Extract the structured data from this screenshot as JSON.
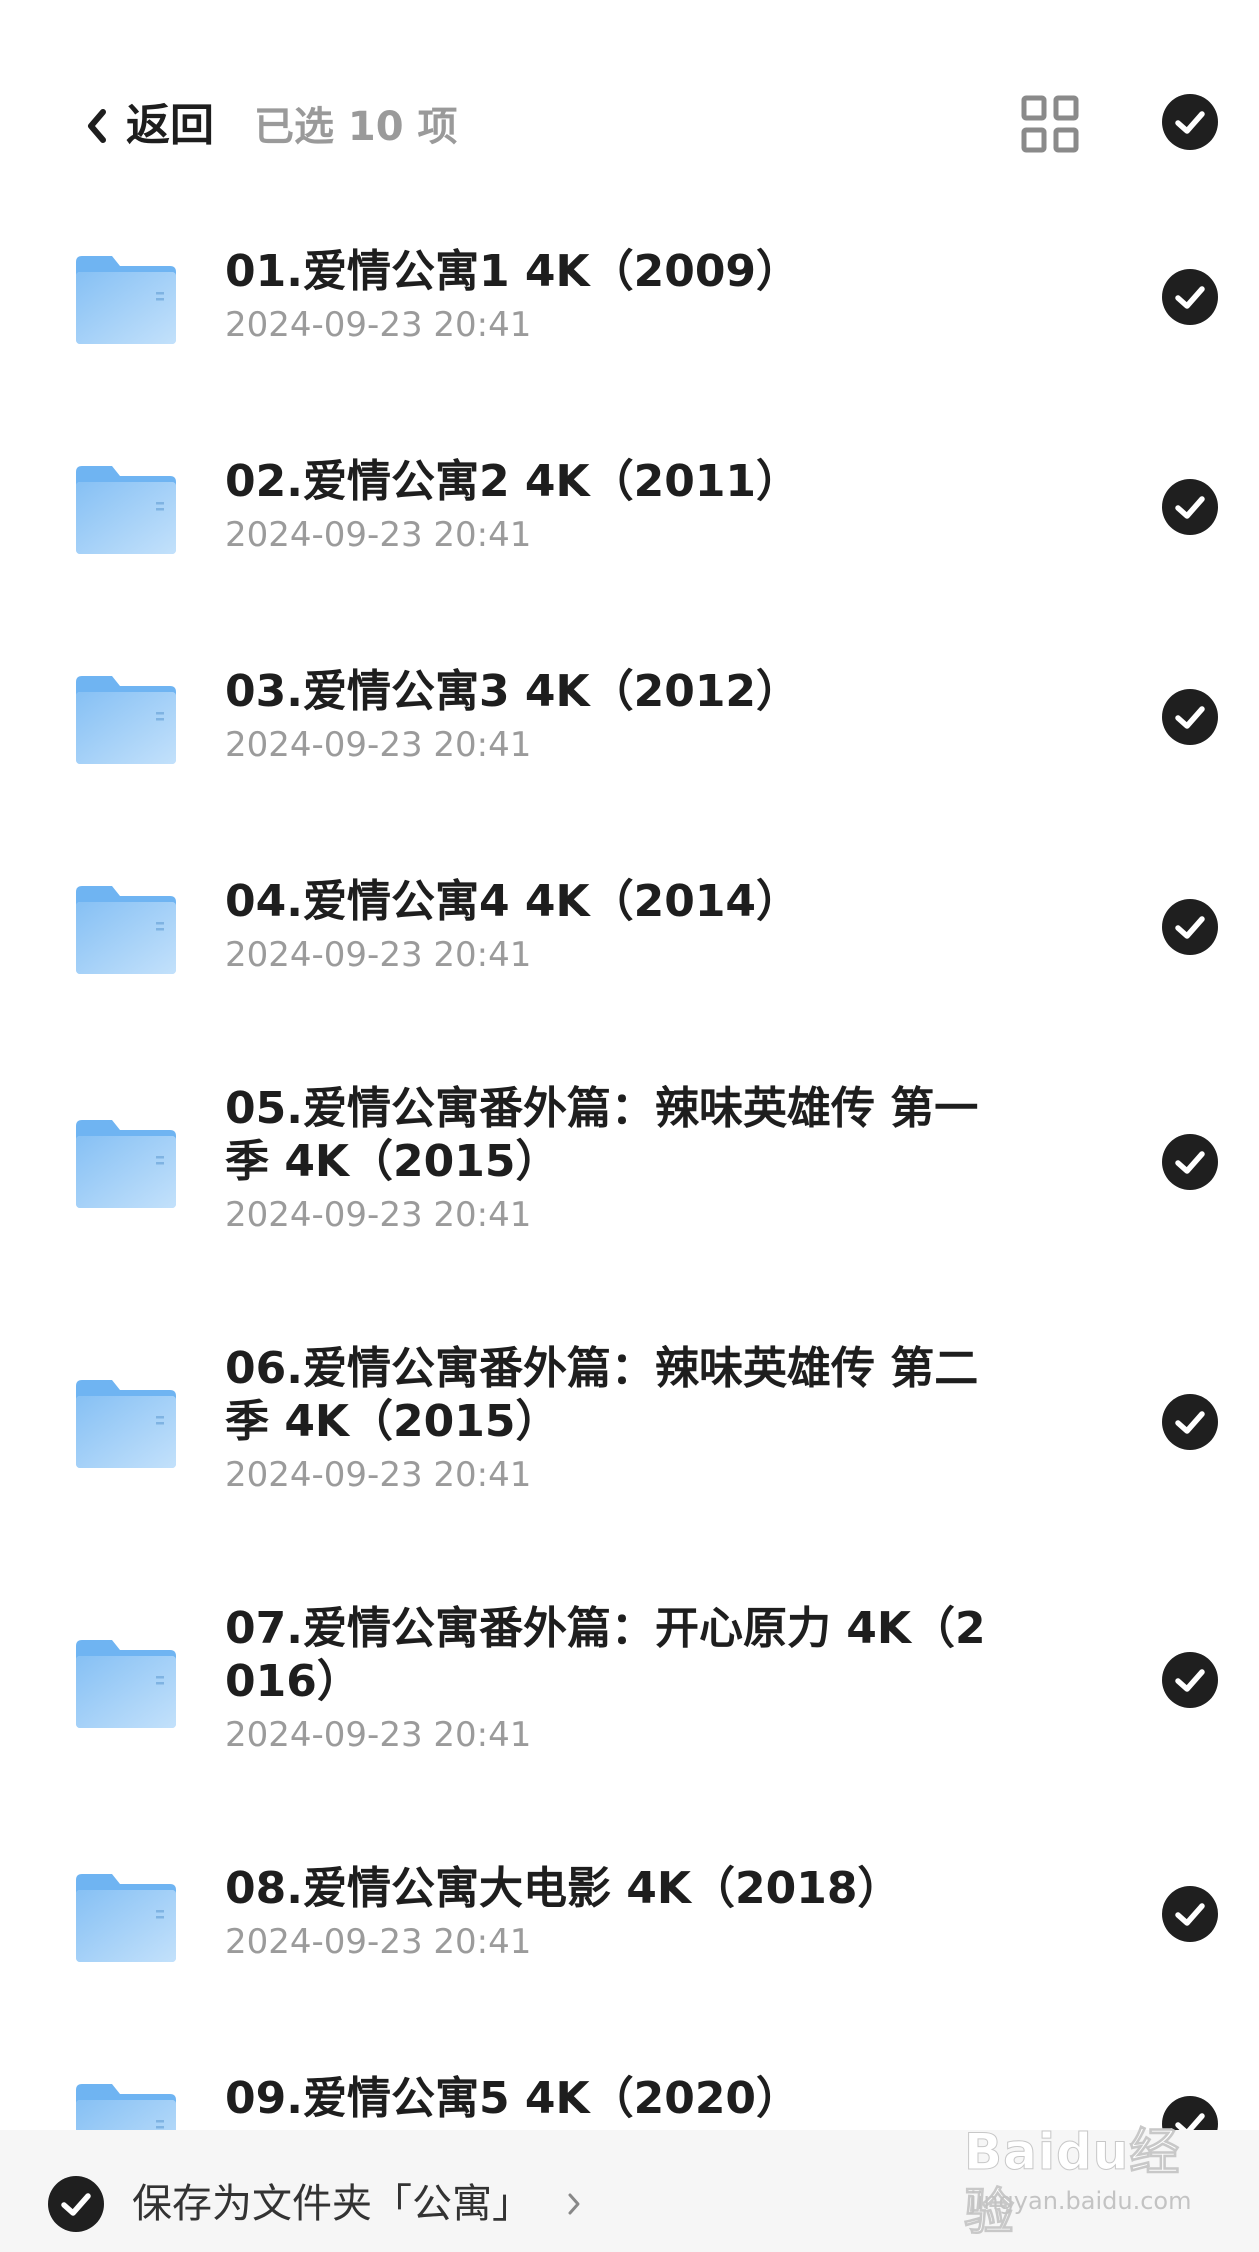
{
  "header": {
    "back_label": "返回",
    "selection_count": "已选 10 项"
  },
  "colors": {
    "accent_check": "#1f1f1f",
    "folder_blue": "#6fb4f2",
    "text_primary": "#1e1e1e",
    "text_secondary": "#9b9b9b"
  },
  "files": [
    {
      "name": "01.爱情公寓1 4K（2009）",
      "date": "2024-09-23 20:41",
      "selected": true
    },
    {
      "name": "02.爱情公寓2 4K（2011）",
      "date": "2024-09-23 20:41",
      "selected": true
    },
    {
      "name": "03.爱情公寓3 4K（2012）",
      "date": "2024-09-23 20:41",
      "selected": true
    },
    {
      "name": "04.爱情公寓4 4K（2014）",
      "date": "2024-09-23 20:41",
      "selected": true
    },
    {
      "name": "05.爱情公寓番外篇：辣味英雄传 第一季 4K（2015）",
      "date": "2024-09-23 20:41",
      "selected": true
    },
    {
      "name": "06.爱情公寓番外篇：辣味英雄传 第二季 4K（2015）",
      "date": "2024-09-23 20:41",
      "selected": true
    },
    {
      "name": "07.爱情公寓番外篇：开心原力 4K（2016）",
      "date": "2024-09-23 20:41",
      "selected": true
    },
    {
      "name": "08.爱情公寓大电影 4K（2018）",
      "date": "2024-09-23 20:41",
      "selected": true
    },
    {
      "name": "09.爱情公寓5 4K（2020）",
      "date": "",
      "selected": true
    }
  ],
  "footer": {
    "save_label": "保存为文件夹「公寓」"
  },
  "watermark": {
    "brand": "Baidu经验",
    "url": "jingyan.baidu.com"
  }
}
